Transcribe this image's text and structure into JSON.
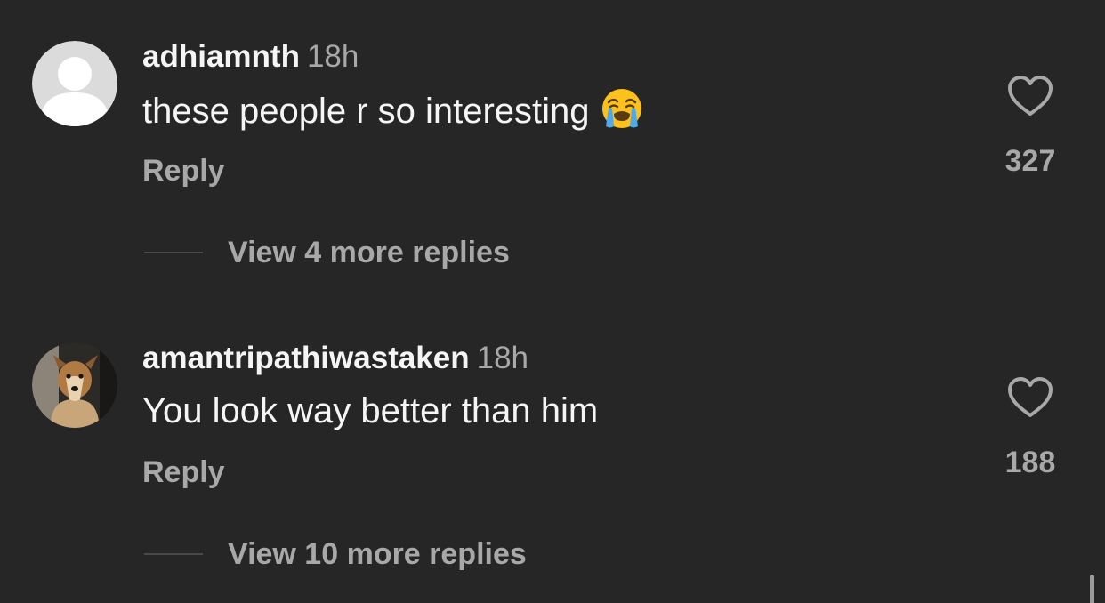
{
  "comments": [
    {
      "username": "adhiamnth",
      "time": "18h",
      "text": "these people r so interesting",
      "emoji": "loudly-crying-face",
      "reply_label": "Reply",
      "view_replies_label": "View 4 more replies",
      "like_count": "327",
      "avatar": "default-avatar"
    },
    {
      "username": "amantripathiwastaken",
      "time": "18h",
      "text": "You look way better than him",
      "reply_label": "Reply",
      "view_replies_label": "View 10 more replies",
      "like_count": "188",
      "avatar": "dog-photo-avatar"
    }
  ],
  "colors": {
    "background": "#262626",
    "primary_text": "#f5f5f5",
    "secondary_text": "#a8a8a8",
    "divider": "#4a4a4a"
  }
}
